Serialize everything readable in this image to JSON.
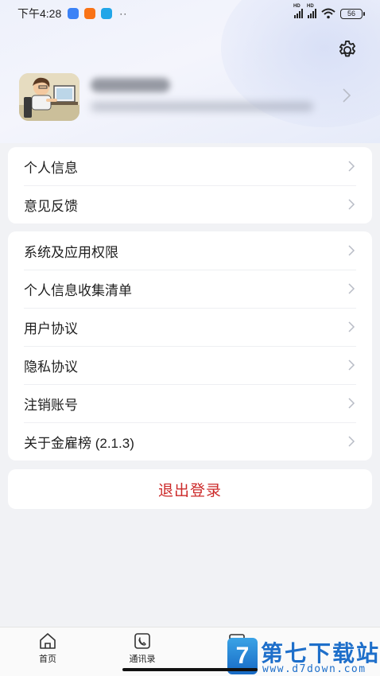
{
  "status_bar": {
    "time": "下午4:28",
    "dots": "··",
    "network_1": "HD",
    "network_2": "HD",
    "battery": "56",
    "app_icon_colors": [
      "#3b82f6",
      "#f97316",
      "#22a6e8"
    ]
  },
  "settings": {
    "icon": "gear-icon"
  },
  "menu_group_1": [
    {
      "label": "个人信息"
    },
    {
      "label": "意见反馈"
    }
  ],
  "menu_group_2": [
    {
      "label": "系统及应用权限"
    },
    {
      "label": "个人信息收集清单"
    },
    {
      "label": "用户协议"
    },
    {
      "label": "隐私协议"
    },
    {
      "label": "注销账号"
    },
    {
      "label": "关于金雇榜 (2.1.3)"
    }
  ],
  "logout": {
    "label": "退出登录"
  },
  "bottom_nav": {
    "home_label": "首页",
    "contacts_label": "通讯录"
  },
  "watermark": {
    "badge": "7",
    "title": "第七下载站",
    "url": "www.d7down.com"
  },
  "colors": {
    "logout_text": "#cc2a2a",
    "background": "#f1f2f5",
    "watermark": "#1e6fca"
  }
}
